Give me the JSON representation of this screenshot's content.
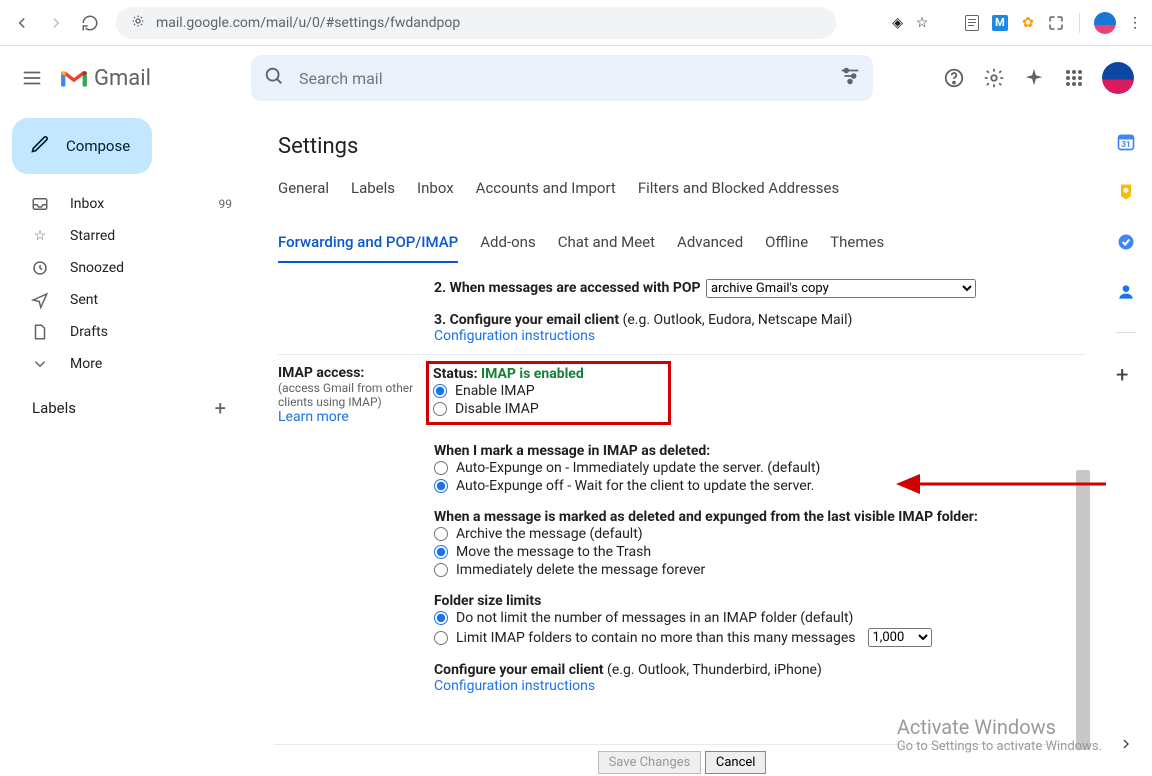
{
  "browser": {
    "url": "mail.google.com/mail/u/0/#settings/fwdandpop"
  },
  "header": {
    "product": "Gmail",
    "search_placeholder": "Search mail"
  },
  "compose": {
    "label": "Compose"
  },
  "nav": {
    "inbox": {
      "label": "Inbox",
      "count": "99"
    },
    "starred": {
      "label": "Starred"
    },
    "snoozed": {
      "label": "Snoozed"
    },
    "sent": {
      "label": "Sent"
    },
    "drafts": {
      "label": "Drafts"
    },
    "more": {
      "label": "More"
    },
    "labels_header": "Labels"
  },
  "page": {
    "title": "Settings"
  },
  "tabs": {
    "general": "General",
    "labels": "Labels",
    "inbox": "Inbox",
    "accounts": "Accounts and Import",
    "filters": "Filters and Blocked Addresses",
    "forwarding": "Forwarding and POP/IMAP",
    "addons": "Add-ons",
    "chat": "Chat and Meet",
    "advanced": "Advanced",
    "offline": "Offline",
    "themes": "Themes"
  },
  "pop": {
    "step2_label": "2. When messages are accessed with POP",
    "step2_select": "archive Gmail's copy",
    "step3_label": "3. Configure your email client ",
    "step3_hint": "(e.g. Outlook, Eudora, Netscape Mail)",
    "config_link": "Configuration instructions"
  },
  "imap": {
    "section_label": "IMAP access:",
    "section_sub": "(access Gmail from other clients using IMAP)",
    "learn_more": "Learn more",
    "status_prefix": "Status: ",
    "status_value": "IMAP is enabled",
    "enable": "Enable IMAP",
    "disable": "Disable IMAP",
    "deleted_heading": "When I mark a message in IMAP as deleted:",
    "expunge_on": "Auto-Expunge on - Immediately update the server. (default)",
    "expunge_off": "Auto-Expunge off - Wait for the client to update the server.",
    "expunged_heading": "When a message is marked as deleted and expunged from the last visible IMAP folder:",
    "archive": "Archive the message (default)",
    "move_trash": "Move the message to the Trash",
    "delete_forever": "Immediately delete the message forever",
    "folder_limits_heading": "Folder size limits",
    "no_limit": "Do not limit the number of messages in an IMAP folder (default)",
    "limit_to": "Limit IMAP folders to contain no more than this many messages",
    "limit_value": "1,000",
    "configure_heading": "Configure your email client ",
    "configure_hint": "(e.g. Outlook, Thunderbird, iPhone)",
    "config_link": "Configuration instructions"
  },
  "buttons": {
    "save": "Save Changes",
    "cancel": "Cancel"
  },
  "watermark": {
    "title": "Activate Windows",
    "sub": "Go to Settings to activate Windows."
  }
}
